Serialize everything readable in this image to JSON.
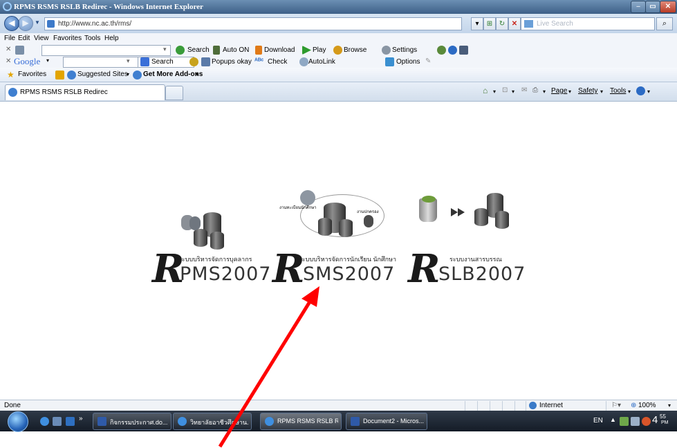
{
  "window": {
    "title": "RPMS RSMS RSLB Redirec - Windows Internet Explorer"
  },
  "address": {
    "url": "http://www.nc.ac.th/rms/",
    "search_placeholder": "Live Search"
  },
  "menu": [
    "File",
    "Edit",
    "View",
    "Favorites",
    "Tools",
    "Help"
  ],
  "toolbar1": {
    "search": "Search",
    "auto_on": "Auto ON",
    "download": "Download",
    "play": "Play",
    "browse": "Browse",
    "settings": "Settings"
  },
  "toolbar2": {
    "google": "Google",
    "search": "Search",
    "popups": "Popups okay",
    "check": "Check",
    "autolink": "AutoLink",
    "options": "Options"
  },
  "favorites": {
    "label": "Favorites",
    "suggested": "Suggested Sites",
    "addons": "Get More Add-ons"
  },
  "tab": {
    "title": "RPMS RSMS RSLB Redirec"
  },
  "commands": {
    "page": "Page",
    "safety": "Safety",
    "tools": "Tools"
  },
  "systems": [
    {
      "code": "PMS2007",
      "thai": "ระบบบริหารจัดการบุคลากร"
    },
    {
      "code": "SMS2007",
      "thai": "ระบบบริหารจัดการนักเรียน นักศึกษา",
      "sub1": "งานทะเบียนนักศึกษา",
      "sub2": "งานปกครอง"
    },
    {
      "code": "SLB2007",
      "thai": "ระบบงานสารบรรณ"
    }
  ],
  "status": {
    "text": "Done",
    "zone": "Internet",
    "zoom": "100%"
  },
  "taskbar": {
    "items": [
      "กิจกรรมประกาศ.do...",
      "วิทยาลัยอาชีวศึกษาน...",
      "RPMS RSMS RSLB R...",
      "Document2 - Micros..."
    ],
    "lang": "EN",
    "time": "4:55 PM",
    "time_hour": "4",
    "time_min": "55",
    "time_ampm": "PM"
  },
  "colors": {
    "arrow": "#ff0000"
  }
}
